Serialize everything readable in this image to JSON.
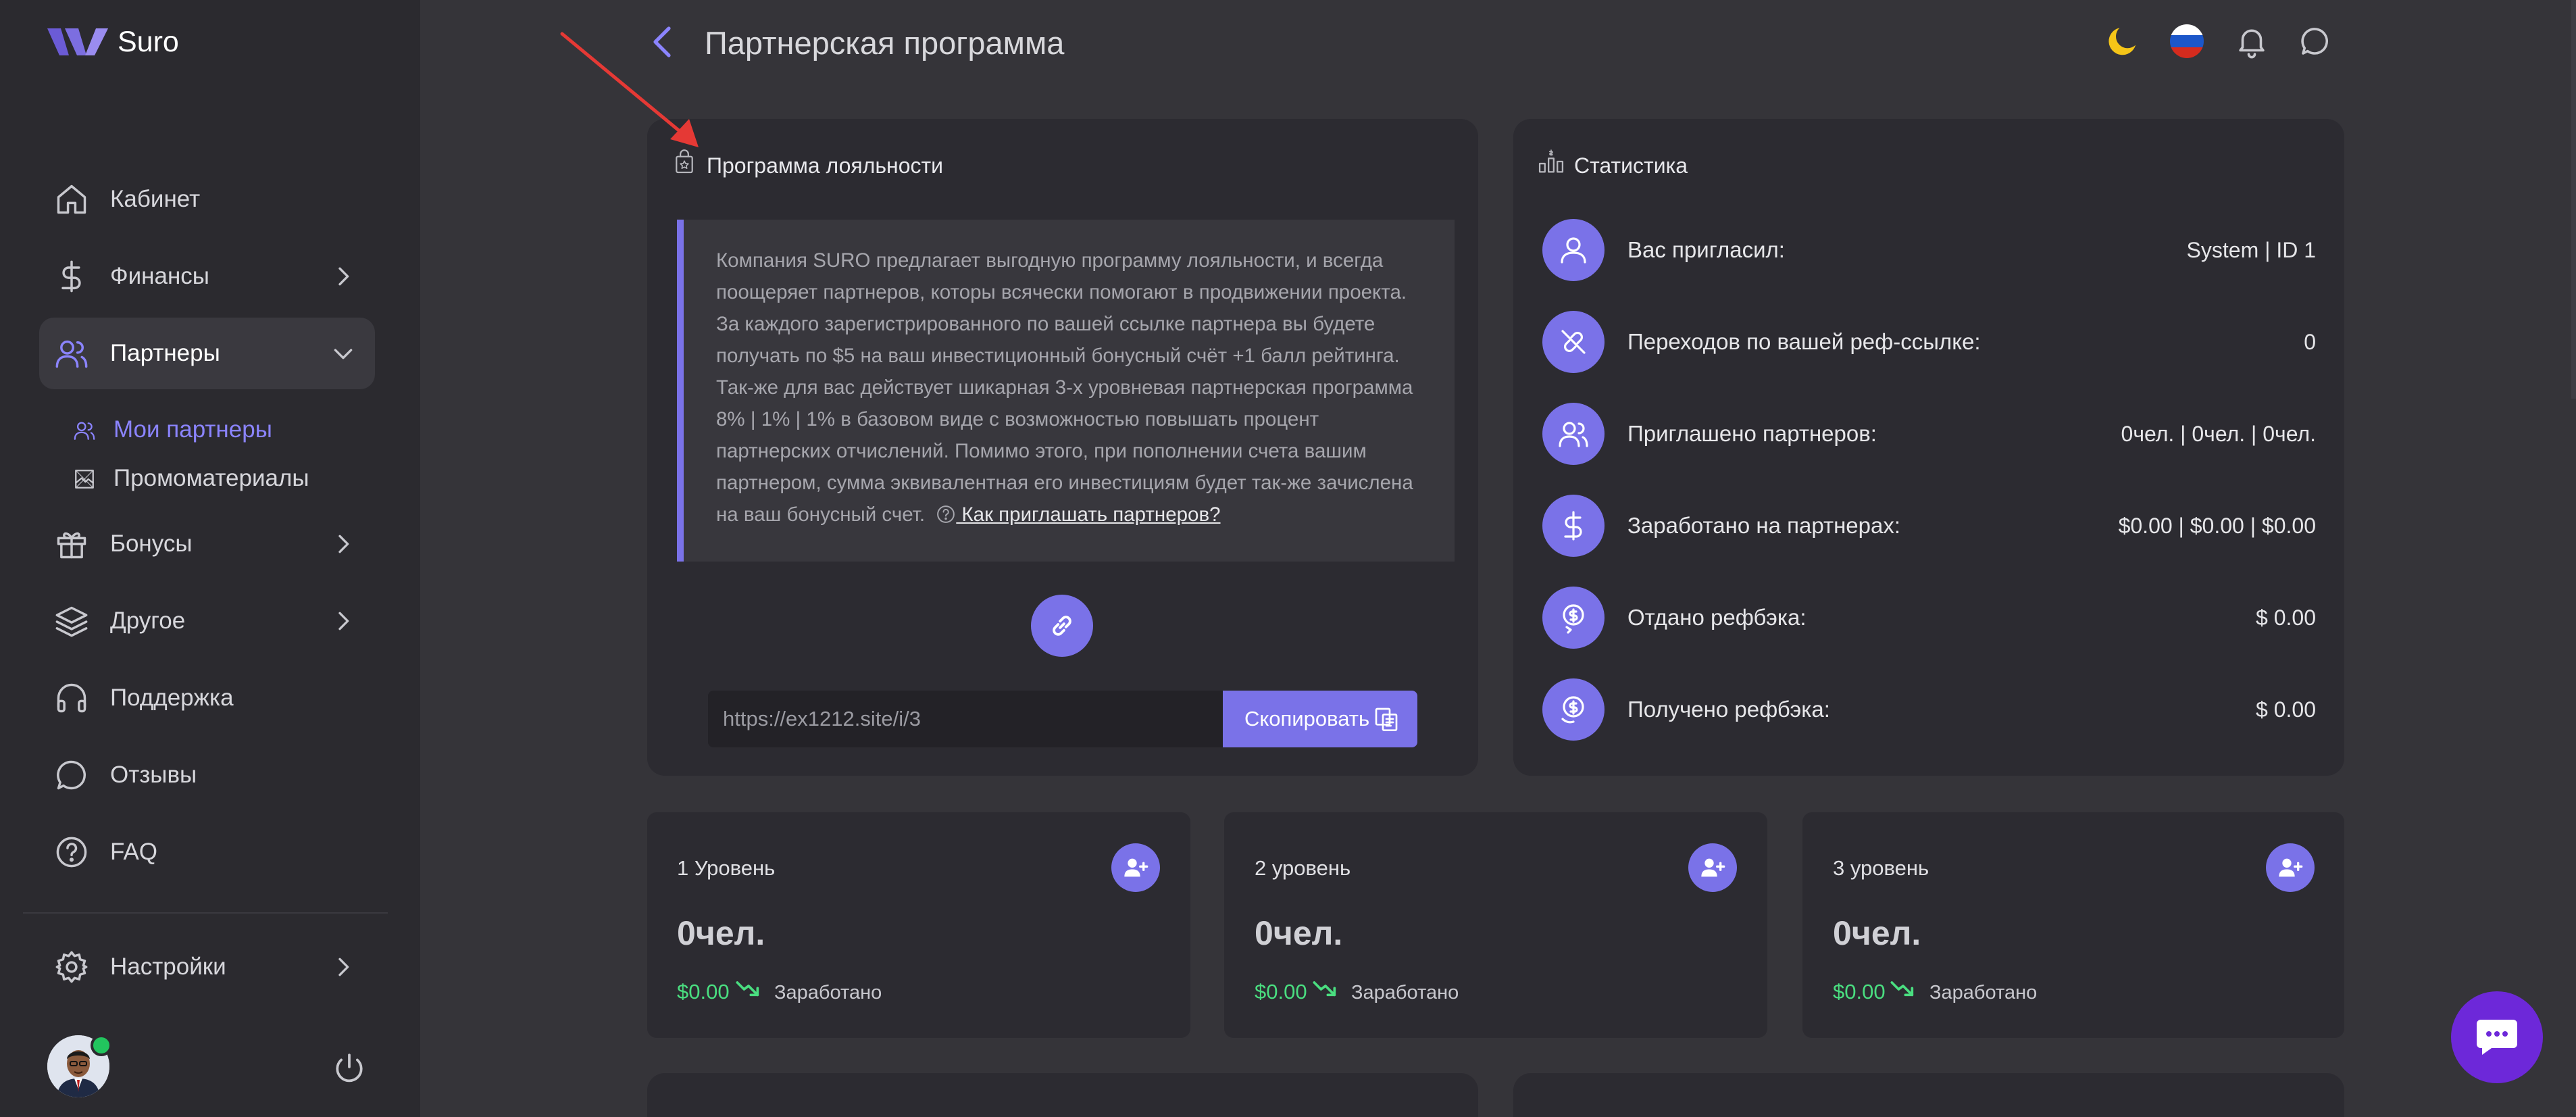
{
  "app": {
    "name": "Suro"
  },
  "header": {
    "title": "Партнерская программа"
  },
  "sidebar": {
    "items": [
      {
        "label": "Кабинет",
        "icon": "home-icon"
      },
      {
        "label": "Финансы",
        "icon": "dollar-icon"
      },
      {
        "label": "Партнеры",
        "icon": "users-icon"
      },
      {
        "label": "Бонусы",
        "icon": "gift-icon"
      },
      {
        "label": "Другое",
        "icon": "layers-icon"
      },
      {
        "label": "Поддержка",
        "icon": "headphones-icon"
      },
      {
        "label": "Отзывы",
        "icon": "chat-icon"
      },
      {
        "label": "FAQ",
        "icon": "help-icon"
      }
    ],
    "subitems": [
      {
        "label": "Мои партнеры",
        "icon": "users-small-icon"
      },
      {
        "label": "Промоматериалы",
        "icon": "image-frame-icon"
      }
    ],
    "settings_label": "Настройки"
  },
  "loyalty": {
    "title": "Программа лояльности",
    "text": "Компания SURO предлагает выгодную программу лояльности, и всегда поощеряет партнеров, которы всячески помогают в продвижении проекта. За каждого зарегистрированного по вашей ссылке партнера вы будете получать по $5 на ваш инвестиционный бонусный счёт +1 балл рейтинга. Так-же для вас действует шикарная 3-х уровневая партнерская программа 8% | 1% | 1% в базовом виде с возможностью повышать процент партнерских отчислений. Помимо этого, при пополнении счета вашим партнером, сумма эквивалентная его инвестициям будет так-же зачислена на ваш бонусный счет.",
    "link_text": " Как приглашать партнеров?",
    "ref_link": "https://ex1212.site/i/3",
    "copy_label": "Скопировать"
  },
  "stats": {
    "title": "Статистика",
    "rows": [
      {
        "label": "Вас пригласил:",
        "value": "System | ID 1"
      },
      {
        "label": "Переходов по вашей реф-ссылке:",
        "value": "0"
      },
      {
        "label": "Приглашено партнеров:",
        "value": "0чел. | 0чел. | 0чел."
      },
      {
        "label": "Заработано на партнерах:",
        "value": "$0.00 | $0.00 | $0.00"
      },
      {
        "label": "Отдано рефбэка:",
        "value": "$ 0.00"
      },
      {
        "label": "Получено рефбэка:",
        "value": "$ 0.00"
      }
    ]
  },
  "levels": [
    {
      "title": "1 Уровень",
      "count": "0чел.",
      "amount": "$0.00",
      "earned_label": "Заработано"
    },
    {
      "title": "2 уровень",
      "count": "0чел.",
      "amount": "$0.00",
      "earned_label": "Заработано"
    },
    {
      "title": "3 уровень",
      "count": "0чел.",
      "amount": "$0.00",
      "earned_label": "Заработано"
    }
  ],
  "colors": {
    "accent": "#7a72e8",
    "success": "#4ade80",
    "background": "#353439",
    "sidebar": "#2b2a2f",
    "card": "#2c2b31"
  }
}
